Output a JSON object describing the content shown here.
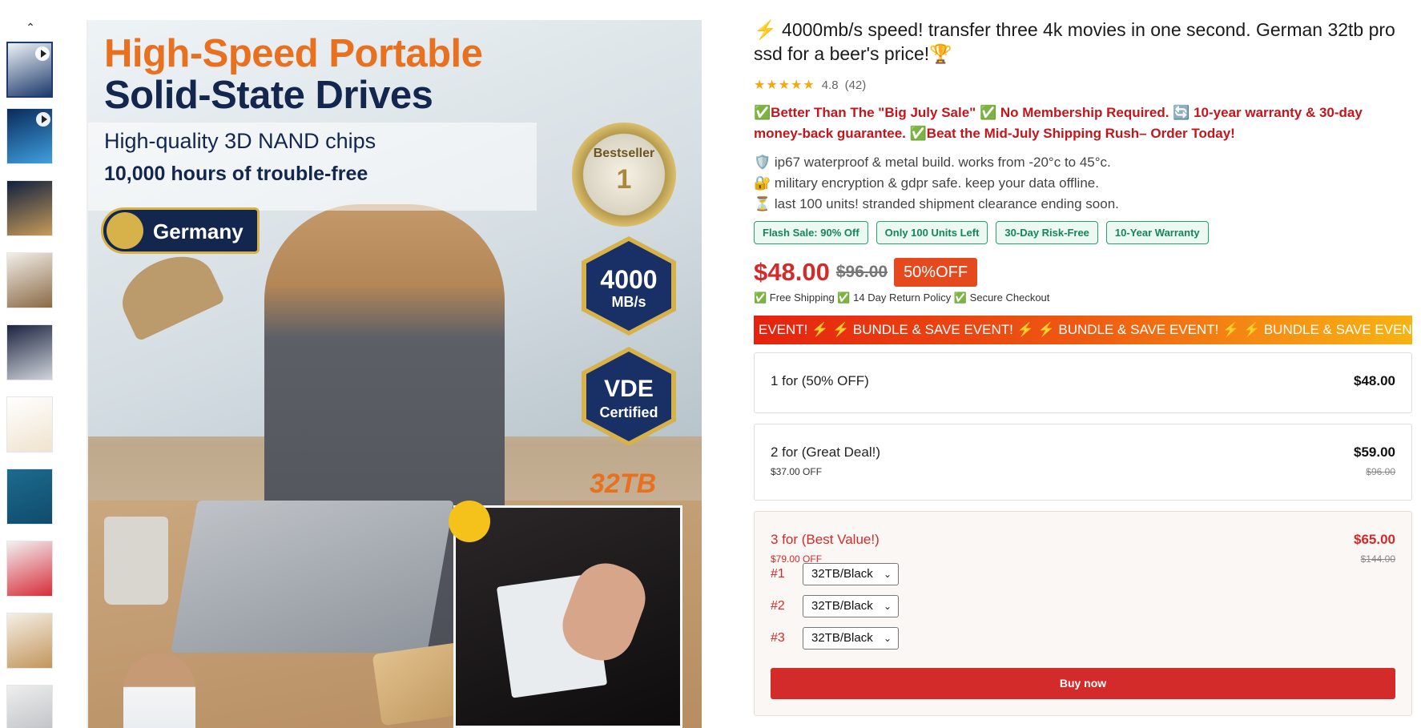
{
  "thumbnails": [
    {
      "name": "thumb-video-1",
      "play": true,
      "colors": [
        "#eef2f7",
        "#1c3a6b"
      ]
    },
    {
      "name": "thumb-video-2",
      "play": true,
      "colors": [
        "#0a2a5a",
        "#3fa0e0"
      ]
    },
    {
      "name": "thumb-3",
      "play": false,
      "colors": [
        "#10203f",
        "#c79b58"
      ]
    },
    {
      "name": "thumb-4",
      "play": false,
      "colors": [
        "#f2eee9",
        "#8a6a44"
      ]
    },
    {
      "name": "thumb-5",
      "play": false,
      "colors": [
        "#1b2440",
        "#d0d4da"
      ]
    },
    {
      "name": "thumb-6",
      "play": false,
      "colors": [
        "#ffffff",
        "#f0e3cf"
      ]
    },
    {
      "name": "thumb-7",
      "play": false,
      "colors": [
        "#1d6a8f",
        "#0f4c6b"
      ]
    },
    {
      "name": "thumb-8",
      "play": false,
      "colors": [
        "#f1f1f1",
        "#d72d3a"
      ]
    },
    {
      "name": "thumb-9",
      "play": false,
      "colors": [
        "#f5efe6",
        "#c2955c"
      ]
    },
    {
      "name": "thumb-10",
      "play": false,
      "colors": [
        "#eeeeee",
        "#b9bcc0"
      ]
    }
  ],
  "main_image": {
    "headline_1": "High-Speed Portable",
    "headline_2": "Solid-State Drives",
    "sub_1": "High-quality 3D NAND chips",
    "sub_2": "10,000 hours of trouble-free",
    "badge_country": "Germany",
    "medal_text": "Bestseller",
    "medal_number": "1",
    "hex_speed_top": "4000",
    "hex_speed_bottom": "MB/s",
    "hex_vde_top": "VDE",
    "hex_vde_bottom": "Certified",
    "capacity": "32TB"
  },
  "product": {
    "title": "⚡ 4000mb/s speed! transfer three 4k movies in one second. German 32tb pro ssd for a beer's price!🏆",
    "stars": "★★★★★",
    "rating": "4.8",
    "review_count": "(42)",
    "promo": "✅Better Than The \"Big July Sale\" ✅ No Membership Required. 🔄 10-year warranty & 30-day money-back guarantee. ✅Beat the Mid-July Shipping Rush– Order Today!",
    "features": [
      "🛡️ ip67 waterproof & metal build. works from -20°c to 45°c.",
      "🔐 military encryption & gdpr safe. keep your data offline.",
      "⏳ last 100 units! stranded shipment clearance ending soon."
    ],
    "tags": [
      "Flash Sale: 90% Off",
      "Only 100 Units Left",
      "30-Day Risk-Free",
      "10-Year Warranty"
    ],
    "price": "$48.00",
    "price_old": "$96.00",
    "discount": "50%OFF",
    "trust": "✅ Free Shipping ✅ 14 Day Return Policy ✅ Secure Checkout",
    "marquee": "EVENT! ⚡    ⚡ BUNDLE & SAVE EVENT! ⚡    ⚡ BUNDLE & SAVE EVENT! ⚡    ⚡ BUNDLE & SAVE EVENT! ⚡"
  },
  "bundles": [
    {
      "label": "1 for (50% OFF)",
      "price": "$48.00"
    },
    {
      "label": "2 for (Great Deal!)",
      "price": "$59.00",
      "sub": "$37.00 OFF",
      "strike": "$96.00"
    },
    {
      "label": "3 for (Best Value!)",
      "price": "$65.00",
      "sub": "$79.00 OFF",
      "strike": "$144.00",
      "selects": [
        {
          "num": "#1",
          "value": "32TB/Black"
        },
        {
          "num": "#2",
          "value": "32TB/Black"
        },
        {
          "num": "#3",
          "value": "32TB/Black"
        }
      ],
      "buy_label": "Buy now"
    }
  ],
  "colors": {
    "accent_red": "#d32a2a",
    "tag_green": "#14865a",
    "star": "#f2a90f"
  }
}
